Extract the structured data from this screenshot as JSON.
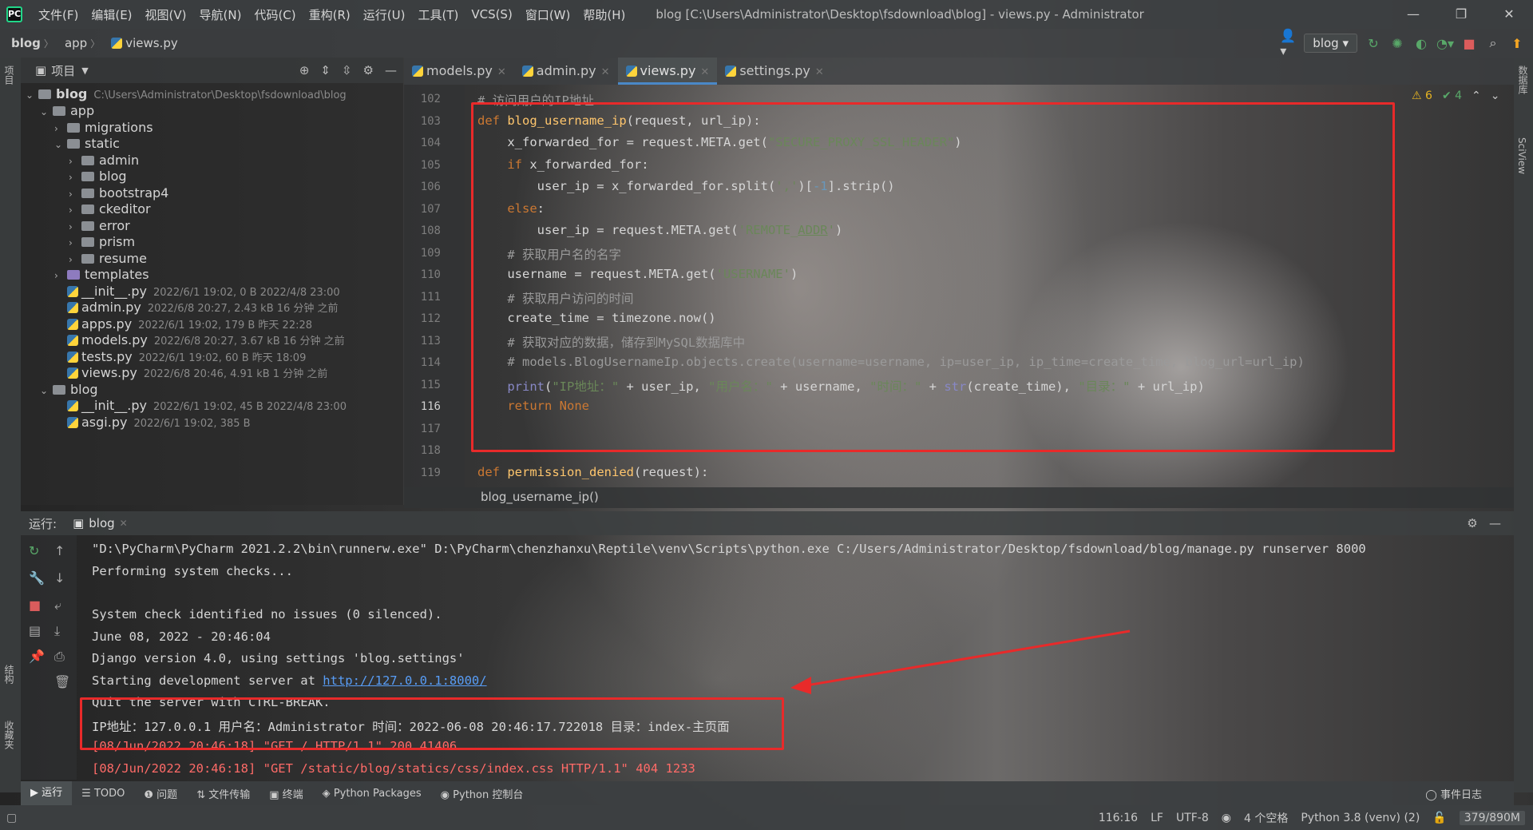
{
  "window": {
    "title": "blog [C:\\Users\\Administrator\\Desktop\\fsdownload\\blog] - views.py - Administrator",
    "menu": [
      "文件(F)",
      "编辑(E)",
      "视图(V)",
      "导航(N)",
      "代码(C)",
      "重构(R)",
      "运行(U)",
      "工具(T)",
      "VCS(S)",
      "窗口(W)",
      "帮助(H)"
    ]
  },
  "nav": {
    "crumbs": [
      "blog",
      "app",
      "views.py"
    ],
    "run_config": "blog"
  },
  "project": {
    "title": "项目",
    "root_name": "blog",
    "root_path": "C:\\Users\\Administrator\\Desktop\\fsdownload\\blog",
    "items": [
      {
        "name": "app"
      },
      {
        "name": "migrations"
      },
      {
        "name": "static"
      },
      {
        "name": "admin"
      },
      {
        "name": "blog"
      },
      {
        "name": "bootstrap4"
      },
      {
        "name": "ckeditor"
      },
      {
        "name": "error"
      },
      {
        "name": "prism"
      },
      {
        "name": "resume"
      },
      {
        "name": "templates"
      },
      {
        "name": "__init__.py",
        "meta": "2022/6/1 19:02, 0 B 2022/4/8 23:00"
      },
      {
        "name": "admin.py",
        "meta": "2022/6/8 20:27, 2.43 kB 16 分钟 之前"
      },
      {
        "name": "apps.py",
        "meta": "2022/6/1 19:02, 179 B 昨天 22:28"
      },
      {
        "name": "models.py",
        "meta": "2022/6/8 20:27, 3.67 kB 16 分钟 之前"
      },
      {
        "name": "tests.py",
        "meta": "2022/6/1 19:02, 60 B 昨天 18:09"
      },
      {
        "name": "views.py",
        "meta": "2022/6/8 20:46, 4.91 kB 1 分钟 之前"
      },
      {
        "name": "blog"
      },
      {
        "name": "__init__.py",
        "meta": "2022/6/1 19:02, 45 B 2022/4/8 23:00"
      },
      {
        "name": "asgi.py",
        "meta": "2022/6/1 19:02, 385 B"
      }
    ]
  },
  "editor": {
    "tabs": [
      "models.py",
      "admin.py",
      "views.py",
      "settings.py"
    ],
    "active_tab": "views.py",
    "line_numbers": [
      "102",
      "103",
      "104",
      "105",
      "106",
      "107",
      "108",
      "109",
      "110",
      "111",
      "112",
      "113",
      "114",
      "115",
      "116",
      "117",
      "118",
      "119"
    ],
    "inspect_warnings": "6",
    "inspect_ok": "4",
    "breadcrumb": "blog_username_ip()",
    "code": {
      "l102": "# 访问用户的IP地址",
      "l103_kw": "def",
      "l103_fn": "blog_username_ip",
      "l103_rest": "(request, url_ip):",
      "l104a": "x_forwarded_for = request.META.get(",
      "l104s": "\"SECURE_PROXY_SSL_HEADER\"",
      "l104b": ")",
      "l105_kw": "if",
      "l105_rest": " x_forwarded_for:",
      "l106a": "user_ip = x_forwarded_for.split(",
      "l106s": "','",
      "l106b": ")[",
      "l106n": "-1",
      "l106c": "].strip()",
      "l107_kw": "else",
      "l107_rest": ":",
      "l108a": "user_ip = request.META.get(",
      "l108s1": "'REMOTE_",
      "l108s2": "ADDR",
      "l108s3": "'",
      "l108b": ")",
      "l109": "# 获取用户名的名字",
      "l110a": "username = request.META.get(",
      "l110s": "'USERNAME'",
      "l110b": ")",
      "l111": "# 获取用户访问的时间",
      "l112": "create_time = timezone.now()",
      "l113": "# 获取对应的数据，储存到MySQL数据库中",
      "l114": "# models.BlogUsernameIp.objects.create(username=username, ip=user_ip, ip_time=create_time, blog_url=url_ip)",
      "l115_print": "print",
      "l115_a": "(",
      "l115_s1": "\"IP地址：\"",
      "l115_b": " + user_ip, ",
      "l115_s2": "\"用户名：\"",
      "l115_c": " + username, ",
      "l115_s3": "\"时间：\"",
      "l115_d": " + ",
      "l115_str": "str",
      "l115_e": "(create_time), ",
      "l115_s4": "\"目录：\"",
      "l115_f": " + url_ip)",
      "l116_kw": "return None",
      "l119_kw": "def",
      "l119_fn": "permission_denied",
      "l119_rest": "(request):"
    }
  },
  "run": {
    "label": "运行:",
    "tab": "blog",
    "lines": [
      "\"D:\\PyCharm\\PyCharm 2021.2.2\\bin\\runnerw.exe\" D:\\PyCharm\\chenzhanxu\\Reptile\\venv\\Scripts\\python.exe C:/Users/Administrator/Desktop/fsdownload/blog/manage.py runserver 8000",
      "Performing system checks...",
      "",
      "System check identified no issues (0 silenced).",
      "June 08, 2022 - 20:46:04",
      "Django version 4.0, using settings 'blog.settings'",
      "Starting development server at ",
      "Quit the server with CTRL-BREAK.",
      "IP地址：127.0.0.1 用户名：Administrator 时间：2022-06-08 20:46:17.722018 目录：index-主页面",
      "[08/Jun/2022 20:46:18] \"GET / HTTP/1.1\" 200 41406",
      "[08/Jun/2022 20:46:18] \"GET /static/blog/statics/css/index.css HTTP/1.1\" 404 1233"
    ],
    "link": "http://127.0.0.1:8000/"
  },
  "bottom_tabs": [
    "运行",
    "TODO",
    "问题",
    "文件传输",
    "终端",
    "Python Packages",
    "Python 控制台"
  ],
  "event_log": "事件日志",
  "status": {
    "position": "116:16",
    "line_sep": "LF",
    "encoding": "UTF-8",
    "indent": "4 个空格",
    "interpreter": "Python 3.8 (venv) (2)",
    "memory": "379/890M"
  },
  "side_tabs": {
    "left_top": "项目",
    "left_mid": "结构",
    "left_bottom": "收藏夹",
    "right_top": "数据库",
    "right_mid": "SciView"
  },
  "colors": {
    "annotation_red": "#e82a2a",
    "keyword": "#cc7832",
    "function": "#ffc66d",
    "string": "#6a8759",
    "error_text": "#ff6b68"
  }
}
